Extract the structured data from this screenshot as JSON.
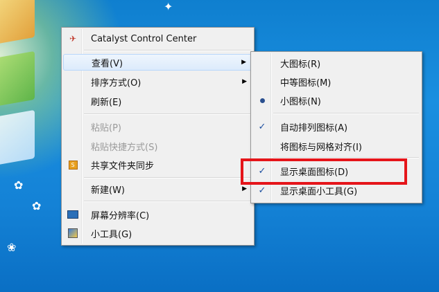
{
  "main_menu": {
    "items": [
      {
        "label": "Catalyst Control Center",
        "icon": "catalyst-icon"
      },
      {
        "label": "查看(V)",
        "has_submenu": true,
        "state": "open"
      },
      {
        "label": "排序方式(O)",
        "has_submenu": true
      },
      {
        "label": "刷新(E)"
      },
      {
        "label": "粘贴(P)",
        "state": "disabled"
      },
      {
        "label": "粘贴快捷方式(S)",
        "state": "disabled"
      },
      {
        "label": "共享文件夹同步",
        "icon": "share-sync-icon"
      },
      {
        "label": "新建(W)",
        "has_submenu": true
      },
      {
        "label": "屏幕分辨率(C)",
        "icon": "monitor-icon"
      },
      {
        "label": "小工具(G)",
        "icon": "gadgets-icon"
      }
    ]
  },
  "view_submenu": {
    "items": [
      {
        "label": "大图标(R)"
      },
      {
        "label": "中等图标(M)"
      },
      {
        "label": "小图标(N)",
        "selected": "radio"
      },
      {
        "label": "自动排列图标(A)",
        "checked": true
      },
      {
        "label": "将图标与网格对齐(I)",
        "checked": false
      },
      {
        "label": "显示桌面图标(D)",
        "checked": true,
        "highlighted": true
      },
      {
        "label": "显示桌面小工具(G)",
        "checked": true
      }
    ]
  },
  "colors": {
    "highlight_box": "#e5151a",
    "menu_bg": "#f0f0f0",
    "desktop_blue": "#1482d6"
  }
}
